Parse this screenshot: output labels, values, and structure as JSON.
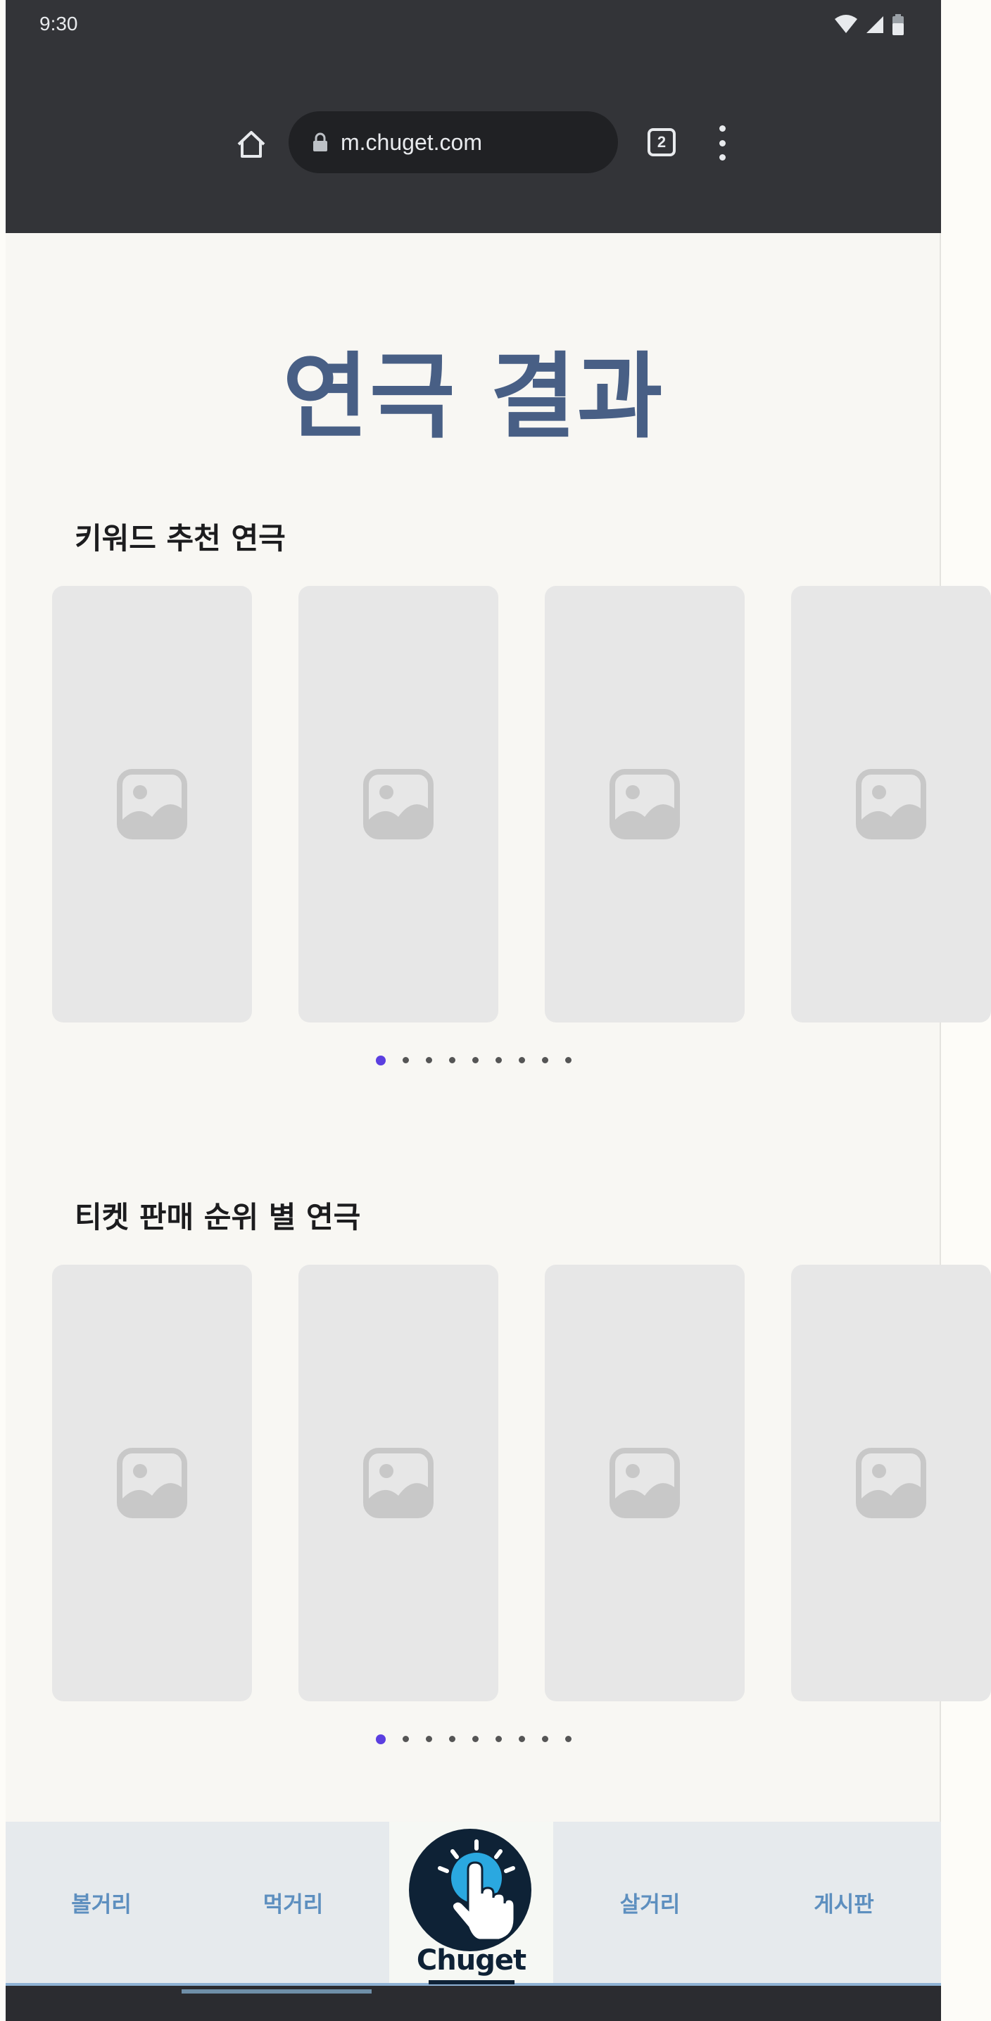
{
  "status_bar": {
    "time": "9:30"
  },
  "browser": {
    "url": "m.chuget.com",
    "tab_count": "2"
  },
  "page": {
    "title": "연극 결과",
    "sections": [
      {
        "title": "키워드 추천 연극",
        "cards": 4,
        "dots": 9,
        "active_dot": 0
      },
      {
        "title": "티켓 판매 순위 별 연극",
        "cards": 4,
        "dots": 9,
        "active_dot": 0
      }
    ]
  },
  "bottom_nav": {
    "items": [
      "볼거리",
      "먹거리",
      "살거리",
      "게시판"
    ],
    "logo_text": "Chuget"
  },
  "colors": {
    "accent": "#5b3fe0",
    "title": "#485f85",
    "nav_text": "#5d8fbf"
  }
}
